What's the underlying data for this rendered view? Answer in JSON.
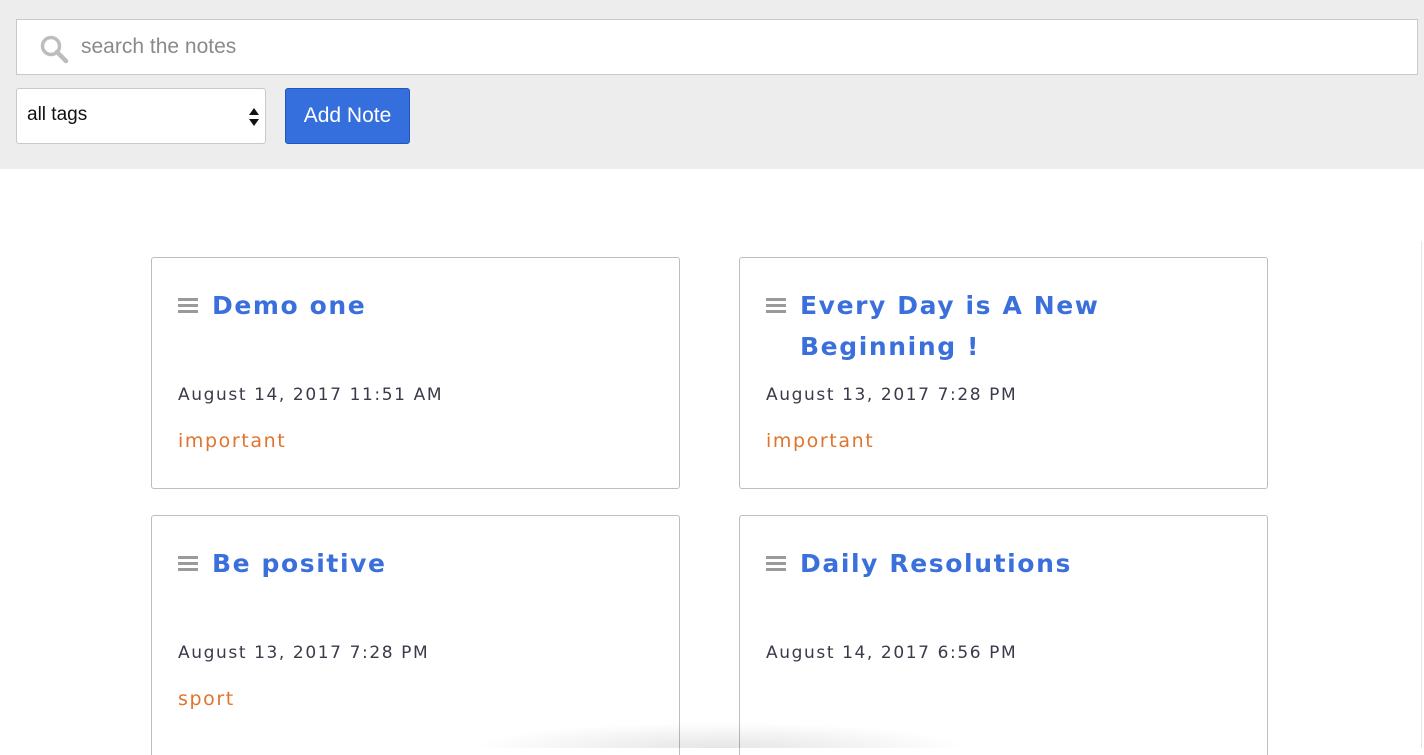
{
  "search": {
    "placeholder": "search the notes",
    "value": ""
  },
  "filter": {
    "selected_label": "all tags"
  },
  "toolbar": {
    "add_label": "Add Note",
    "accent_color": "#356fde"
  },
  "notes": [
    {
      "title": "Demo one",
      "date": "August 14, 2017 11:51 AM",
      "tag": "important"
    },
    {
      "title": "Every Day is A New Beginning !",
      "date": "August 13, 2017 7:28 PM",
      "tag": "important"
    },
    {
      "title": "Be positive",
      "date": "August 13, 2017 7:28 PM",
      "tag": "sport"
    },
    {
      "title": "Daily Resolutions",
      "date": "August 14, 2017 6:56 PM",
      "tag": ""
    }
  ],
  "colors": {
    "title": "#3a6fdc",
    "tag": "#e0742c",
    "header_bg": "#ededed"
  }
}
